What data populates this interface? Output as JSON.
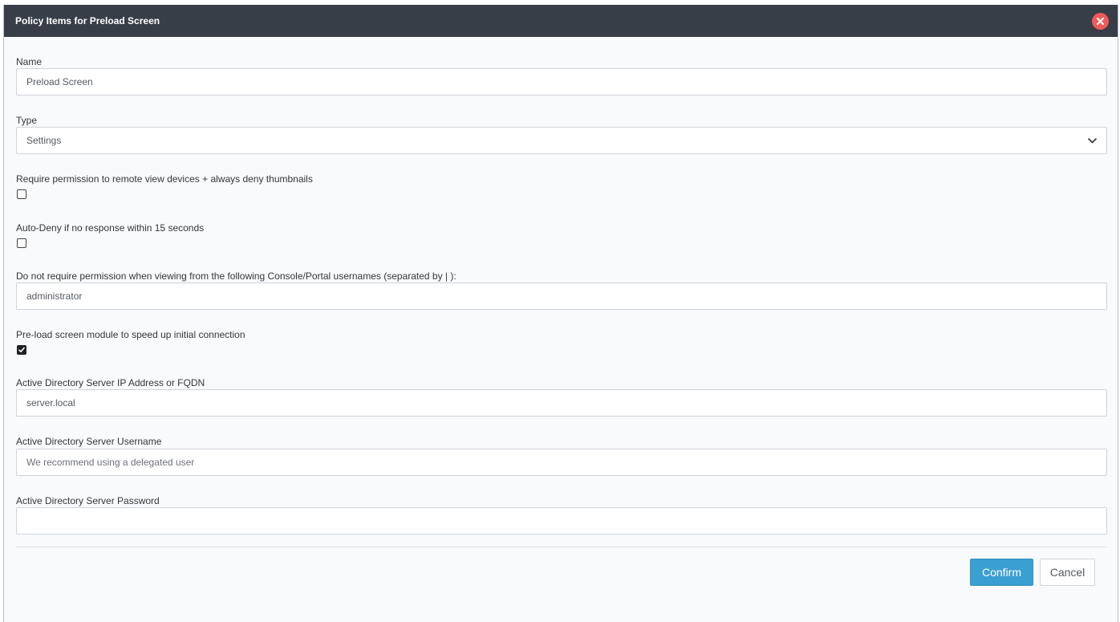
{
  "dialog": {
    "title": "Policy Items for Preload Screen",
    "close_icon": "close-icon"
  },
  "fields": {
    "name": {
      "label": "Name",
      "value": "Preload Screen"
    },
    "type": {
      "label": "Type",
      "selected": "Settings",
      "icon": "chevron-down-icon"
    },
    "require_permission": {
      "label": "Require permission to remote view devices + always deny thumbnails",
      "checked": false
    },
    "auto_deny": {
      "label": "Auto-Deny if no response within 15 seconds",
      "checked": false
    },
    "exempt_usernames": {
      "label": "Do not require permission when viewing from the following Console/Portal usernames (separated by | ):",
      "value": "administrator"
    },
    "preload_module": {
      "label": "Pre-load screen module to speed up initial connection",
      "checked": true
    },
    "ad_server": {
      "label": "Active Directory Server IP Address or FQDN",
      "value": "server.local"
    },
    "ad_username": {
      "label": "Active Directory Server Username",
      "placeholder": "We recommend using a delegated user",
      "value": ""
    },
    "ad_password": {
      "label": "Active Directory Server Password",
      "value": ""
    }
  },
  "footer": {
    "confirm_label": "Confirm",
    "cancel_label": "Cancel"
  },
  "colors": {
    "header_bg": "#383e47",
    "close_red": "#f05a5a",
    "confirm_blue": "#3a9fd1"
  }
}
